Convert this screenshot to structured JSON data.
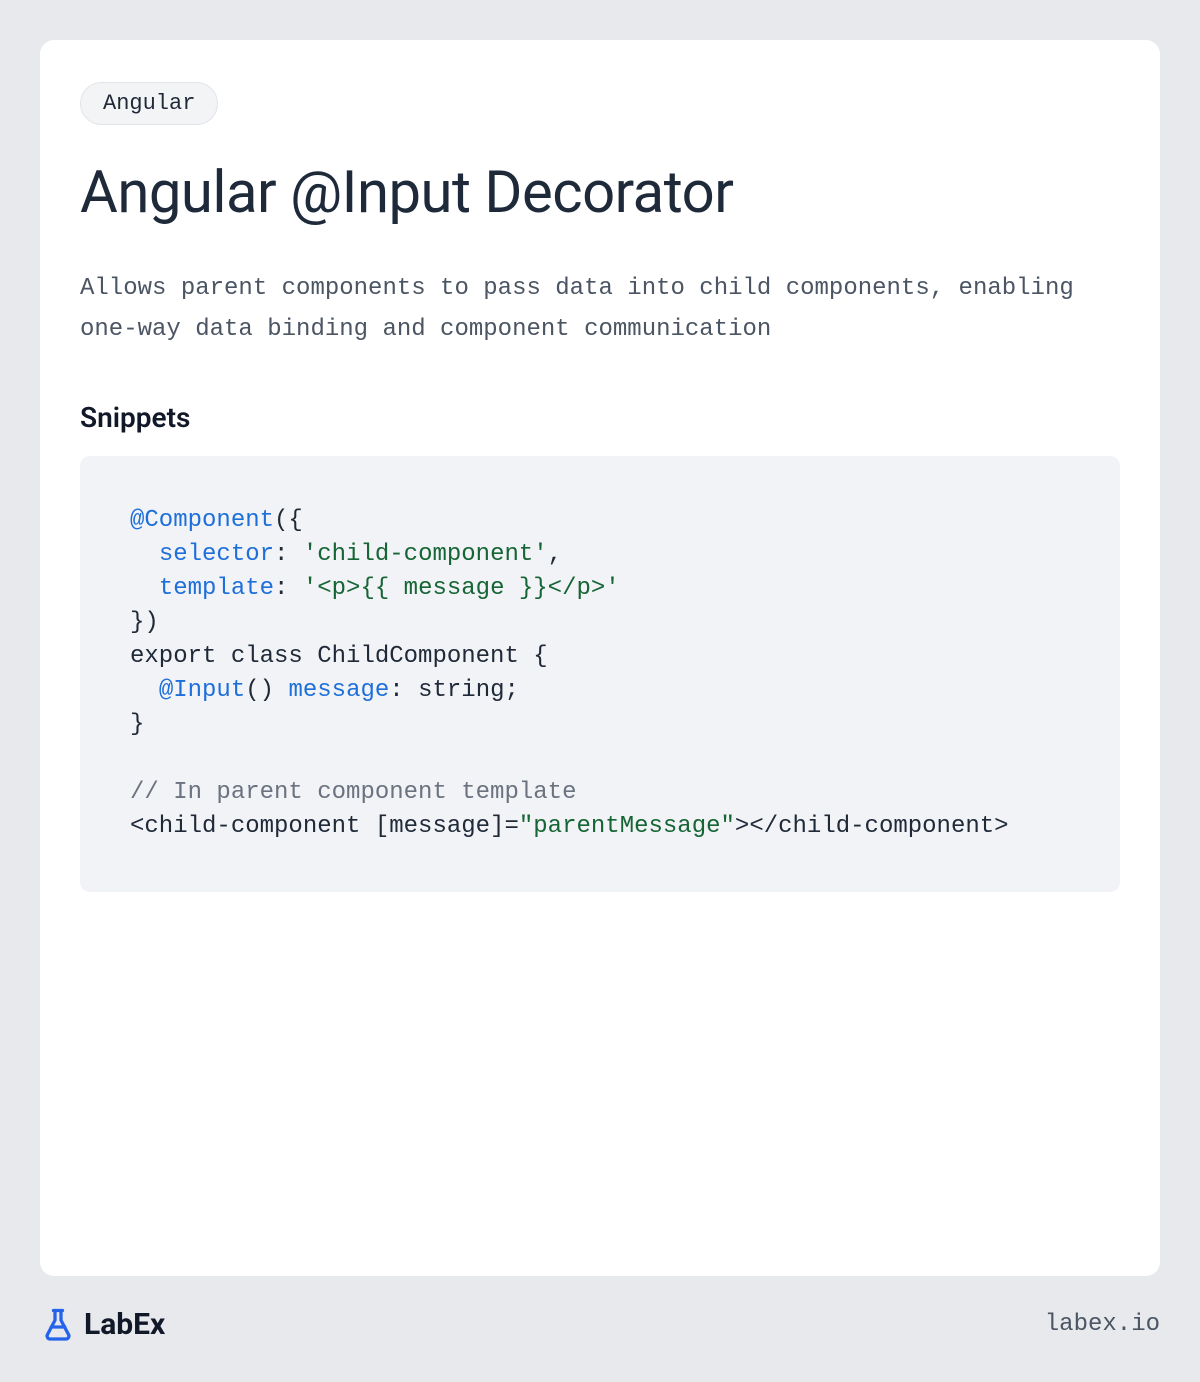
{
  "tag": "Angular",
  "title": "Angular @Input Decorator",
  "description": "Allows parent components to pass data into child components, enabling one-way data binding and component communication",
  "snippets_heading": "Snippets",
  "code": {
    "t1": "@Component",
    "t2": "({",
    "t3": "  ",
    "t4": "selector",
    "t5": ": ",
    "t6": "'child-component'",
    "t7": ",",
    "t8": "  ",
    "t9": "template",
    "t10": ": ",
    "t11": "'<p>{{ message }}</p>'",
    "t12": "})",
    "t13": "export class ChildComponent {",
    "t14": "  ",
    "t15": "@Input",
    "t16": "() ",
    "t17": "message",
    "t18": ": string;",
    "t19": "}",
    "t20": "// In parent component template",
    "t21": "<child-component [message]=",
    "t22": "\"parentMessage\"",
    "t23": "></child-component>"
  },
  "logo_text": "LabEx",
  "footer_url": "labex.io"
}
